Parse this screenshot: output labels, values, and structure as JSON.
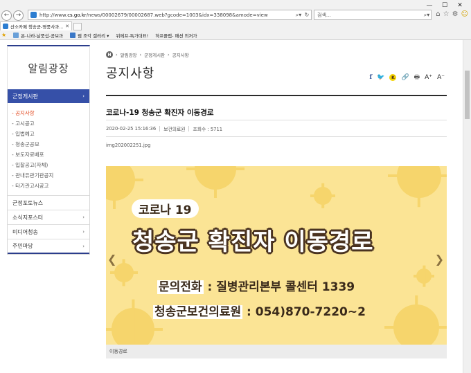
{
  "browser": {
    "url_prefix": "http://www.",
    "url_domain": "cs.go.kr",
    "url_rest": "/news/00002679/00002687.web?gcode=1003&idx=338098&amode=view",
    "search_placeholder": "검색...",
    "tab_title": "산소카페 청송군-영풍사과...",
    "favorites": [
      {
        "label": "온-나라-날풍섭-공보과"
      },
      {
        "label": "웹 조각 갤러리 ▾"
      },
      {
        "label": "위메프-특가대표!"
      },
      {
        "label": "하프플랩- 패션 최저가"
      }
    ]
  },
  "sidebar": {
    "title": "알림광장",
    "active": "군정게시판",
    "sub_items": [
      {
        "label": "- 공지사항"
      },
      {
        "label": "- 고시공고"
      },
      {
        "label": "- 입법예고"
      },
      {
        "label": "- 청송군공보"
      },
      {
        "label": "- 보도자료배포"
      },
      {
        "label": "- 입찰공고(자체)"
      },
      {
        "label": "- 관내유관기관공지"
      },
      {
        "label": "- 타기관고시공고"
      }
    ],
    "rows": [
      {
        "label": "군정포토뉴스",
        "chevron": ""
      },
      {
        "label": "소식지포스터",
        "chevron": "›"
      },
      {
        "label": "미디어청송",
        "chevron": "›"
      },
      {
        "label": "주민마당",
        "chevron": "›"
      }
    ]
  },
  "breadcrumb": {
    "home": "H",
    "items": [
      "알림광장",
      "군정게시판",
      "공지사항"
    ]
  },
  "page_title": "공지사항",
  "share": {
    "facebook": "f",
    "twitter": "🐦",
    "kakao": "K",
    "link": "🔗",
    "print": "🖶",
    "font_up": "A⁺",
    "font_down": "A⁻"
  },
  "post": {
    "title": "코로나-19 청송군 확진자 이동경로",
    "date": "2020-02-25 15:16:36",
    "author": "보건의료원",
    "views": "조회수 : 5711",
    "attachment": "img202002251.jpg"
  },
  "banner": {
    "pill": "코로나 19",
    "headline": "청송군 확진자 이동경로",
    "line1_label": "문의전화",
    "line1_rest": " : 질병관리본부 콜센터 1339",
    "line2_label": "청송군보건의료원",
    "line2_rest": " : 054)870-7220~2",
    "caption": "이동경로"
  },
  "colors": {
    "accent": "#3650a8",
    "active_sub": "#e2461c",
    "banner_bg": "#fbe495"
  }
}
